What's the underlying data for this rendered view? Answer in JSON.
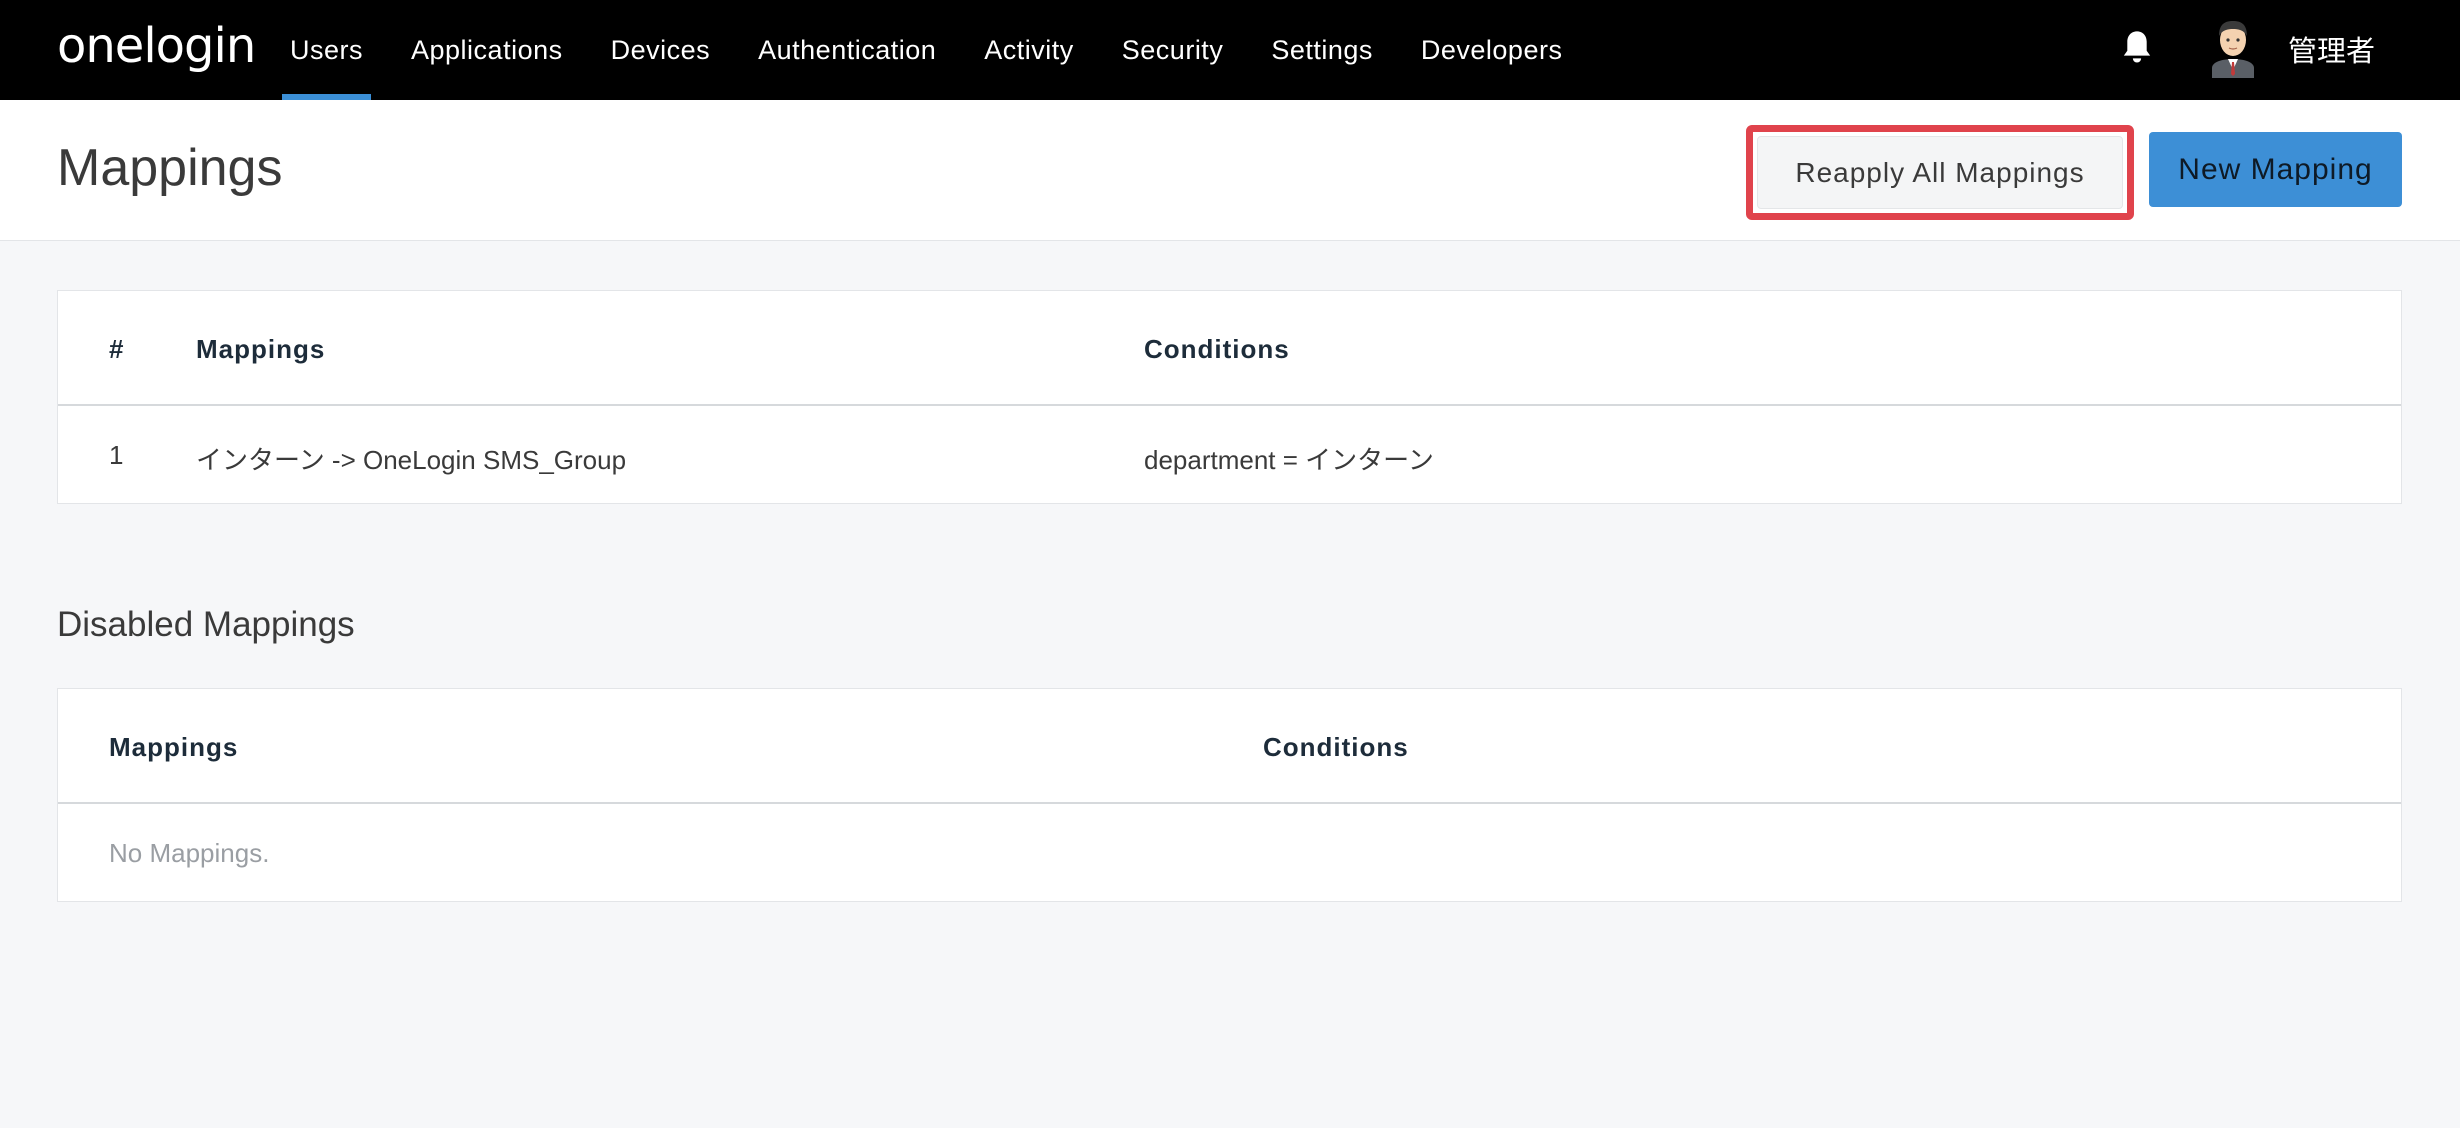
{
  "topbar": {
    "logo": "onelogin",
    "nav": [
      {
        "label": "Users",
        "active": true
      },
      {
        "label": "Applications",
        "active": false
      },
      {
        "label": "Devices",
        "active": false
      },
      {
        "label": "Authentication",
        "active": false
      },
      {
        "label": "Activity",
        "active": false
      },
      {
        "label": "Security",
        "active": false
      },
      {
        "label": "Settings",
        "active": false
      },
      {
        "label": "Developers",
        "active": false
      }
    ],
    "username": "管理者",
    "icons": {
      "bell": "bell-icon",
      "avatar": "avatar"
    }
  },
  "header": {
    "title": "Mappings",
    "reapply_label": "Reapply All Mappings",
    "new_label": "New Mapping"
  },
  "mappings_table": {
    "columns": [
      "#",
      "Mappings",
      "Conditions"
    ],
    "rows": [
      {
        "num": "1",
        "mapping": "インターン -> OneLogin SMS_Group",
        "condition": "department = インターン"
      }
    ]
  },
  "disabled": {
    "title": "Disabled Mappings",
    "columns": [
      "Mappings",
      "Conditions"
    ],
    "empty_text": "No Mappings."
  },
  "colors": {
    "topbar": "#000000",
    "accent": "#3d8fd6",
    "highlight": "#e0434c",
    "page_bg": "#f6f7f9"
  }
}
